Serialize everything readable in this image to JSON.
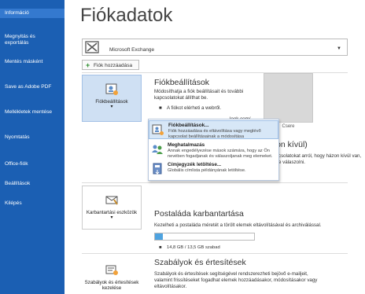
{
  "sidebar": {
    "items": [
      {
        "label": "Információ",
        "active": true
      },
      {
        "label": "Megnyitás és exportálás"
      },
      {
        "label": "Mentés másként"
      },
      {
        "label": "Save as Adobe PDF"
      },
      {
        "label": "Mellékletek mentése"
      },
      {
        "label": "Nyomtatás"
      },
      {
        "label": "Office-fiók"
      },
      {
        "label": "Beállítások"
      },
      {
        "label": "Kilépés"
      }
    ]
  },
  "page": {
    "title": "Fiókadatok"
  },
  "account": {
    "name": "Microsoft Exchange",
    "add_label": "Fiók hozzáadása"
  },
  "settings": {
    "button_label": "Fiókbeállítások",
    "title": "Fiókbeállítások",
    "desc_line1": "Módosíthatja a fiók beállításait és további",
    "desc_line2": "kapcsolatokat állíthat be.",
    "web_text": "A fiókot elérheti a webről.",
    "web_link": "look.com/"
  },
  "avatar": {
    "label": "Csere"
  },
  "menu": {
    "items": [
      {
        "title": "Fiókbeállítások...",
        "desc1": "Fiók hozzáadása és eltávolítása vagy meglévő",
        "desc2": "kapcsolat beállításainak a módosítása"
      },
      {
        "title": "Meghatalmazás",
        "desc1": "Annak engedélyezése mások számára, hogy az Ön",
        "desc2": "nevében fogadjanak és válaszoljanak meg elemeket."
      },
      {
        "title": "Címjegyzék letöltése...",
        "desc1": "Globális címlista példányának letöltése.",
        "desc2": ""
      }
    ]
  },
  "background": {
    "ooo_title": "ázon kívül)",
    "ooo_line1": "kapcsolatokat arról, hogy házon kívül van,",
    "ooo_line2": "lekre válaszolni."
  },
  "mailbox": {
    "button_label": "Karbantartási eszközök",
    "title": "Postaláda karbantartása",
    "desc": "Kezelheti a postaláda méretét a törölt elemek eltávolításával és archiválással.",
    "usage_text": "14,8 GB / 13,5 GB szabad",
    "usage_fraction": 0.08
  },
  "rules": {
    "button_label": "Szabályok és értesítések kezelése",
    "title": "Szabályok és értesítések",
    "line1": "Szabályok és értesítések segítségével rendszerezheti bejövő e-mailjeit,",
    "line2": "valamint frissítéseket fogadhat elemek hozzáadásakor, módosításakor vagy",
    "line3": "eltávolításakor."
  }
}
